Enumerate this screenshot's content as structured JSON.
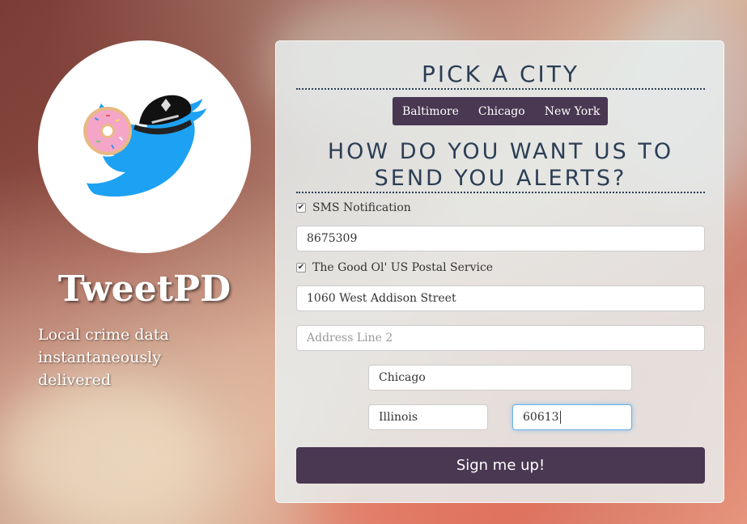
{
  "brand": {
    "name": "TweetPD",
    "tagline": "Local crime data instantaneously delivered"
  },
  "city_section": {
    "heading": "PICK A CITY",
    "cities": [
      "Baltimore",
      "Chicago",
      "New York"
    ]
  },
  "alerts_section": {
    "heading": "HOW DO YOU WANT US TO SEND YOU ALERTS?",
    "sms": {
      "label": "SMS Notification",
      "checked": true,
      "phone": "8675309"
    },
    "mail": {
      "label": "The Good Ol' US Postal Service",
      "checked": true,
      "address1": "1060 West Addison Street",
      "address2_placeholder": "Address Line 2",
      "city": "Chicago",
      "state": "Illinois",
      "zip": "60613"
    }
  },
  "submit_label": "Sign me up!",
  "colors": {
    "accent": "#4a3752",
    "heading": "#2c3e55",
    "twitter_blue": "#1da1f2"
  },
  "icons": {
    "logo": "twitter-bird-police-donut-icon",
    "check": "checkmark-icon"
  }
}
